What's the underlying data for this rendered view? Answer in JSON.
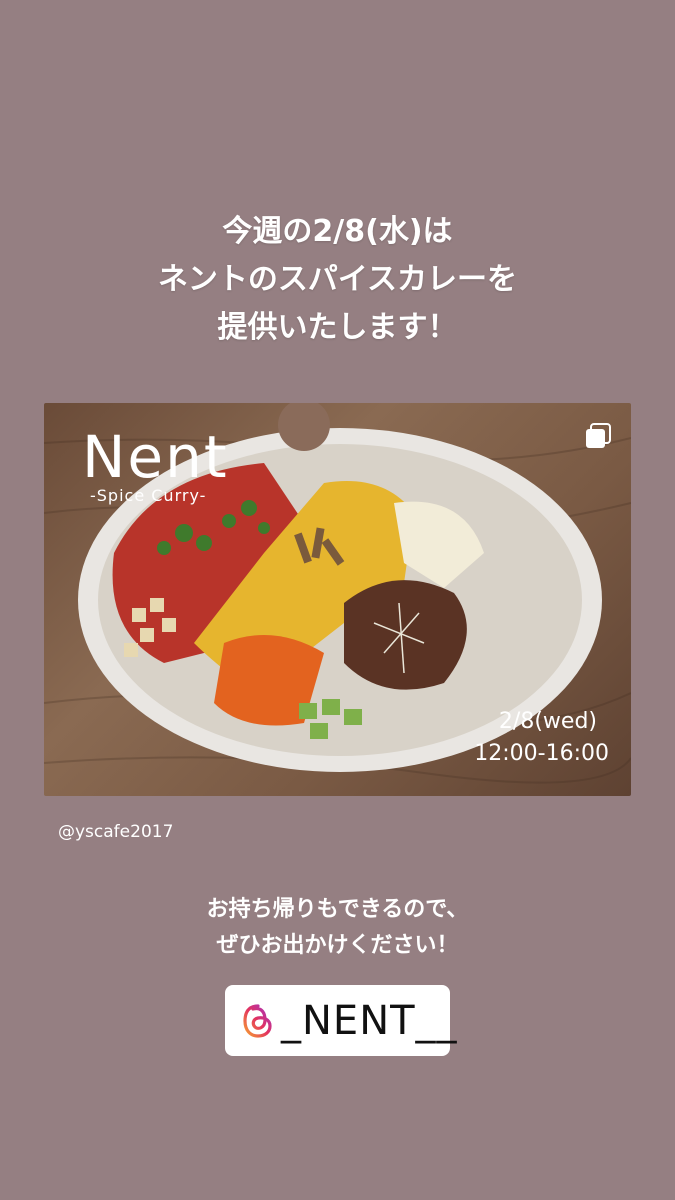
{
  "headline": {
    "line1": "今週の2/8(水)は",
    "line2": "ネントのスパイスカレーを",
    "line3": "提供いたします！"
  },
  "post": {
    "brand": "Nent",
    "brand_sub": "-Spice Curry-",
    "date": "2/8(wed)",
    "time": "12:00-16:00",
    "icons": {
      "multi": "multiple-posts-icon"
    }
  },
  "username": "@yscafe2017",
  "subline": {
    "line1": "お持ち帰りもできるので、",
    "line2": "ぜひお出かけください！"
  },
  "mention": {
    "handle": "_NENT__",
    "icon": "threads-icon"
  },
  "colors": {
    "background": "#957f82",
    "text": "#ffffff"
  }
}
